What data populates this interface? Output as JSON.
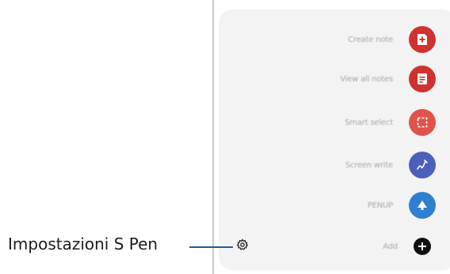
{
  "callout": {
    "label": "Impostazioni S Pen"
  },
  "air_command": {
    "items": [
      {
        "label": "Create note",
        "icon": "create-note-icon",
        "color": "#d0322f"
      },
      {
        "label": "View all notes",
        "icon": "view-all-notes-icon",
        "color": "#d0322f"
      },
      {
        "label": "Smart select",
        "icon": "smart-select-icon",
        "color": "#e0524a"
      },
      {
        "label": "Screen write",
        "icon": "screen-write-icon",
        "color": "#4c5fbd"
      },
      {
        "label": "PENUP",
        "icon": "penup-icon",
        "color": "#2f7fd1"
      },
      {
        "label": "Add",
        "icon": "add-icon",
        "color": "#111111"
      }
    ]
  },
  "settings": {
    "icon": "gear-icon"
  },
  "colors": {
    "panel": "#f3f3f3",
    "callout_line": "#1f5c9a"
  }
}
